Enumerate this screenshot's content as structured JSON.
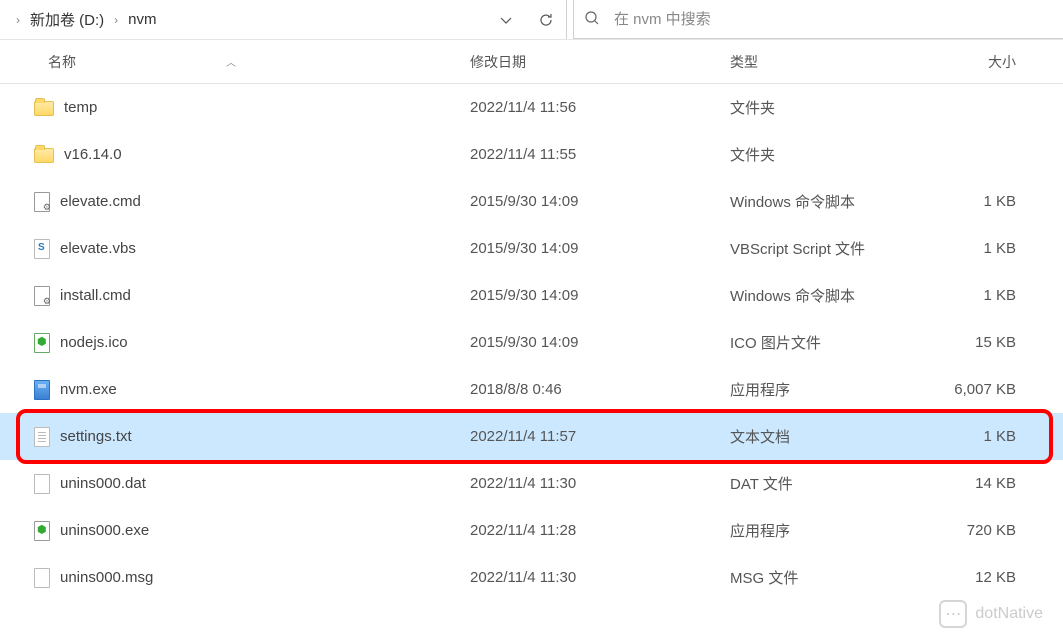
{
  "breadcrumb": {
    "items": [
      "新加卷 (D:)",
      "nvm"
    ]
  },
  "search": {
    "placeholder": "在 nvm 中搜索"
  },
  "columns": {
    "name": "名称",
    "date": "修改日期",
    "type": "类型",
    "size": "大小"
  },
  "files": [
    {
      "name": "temp",
      "date": "2022/11/4 11:56",
      "type": "文件夹",
      "size": "",
      "icon": "folder",
      "selected": false
    },
    {
      "name": "v16.14.0",
      "date": "2022/11/4 11:55",
      "type": "文件夹",
      "size": "",
      "icon": "folder",
      "selected": false
    },
    {
      "name": "elevate.cmd",
      "date": "2015/9/30 14:09",
      "type": "Windows 命令脚本",
      "size": "1 KB",
      "icon": "cmd",
      "selected": false
    },
    {
      "name": "elevate.vbs",
      "date": "2015/9/30 14:09",
      "type": "VBScript Script 文件",
      "size": "1 KB",
      "icon": "vbs",
      "selected": false
    },
    {
      "name": "install.cmd",
      "date": "2015/9/30 14:09",
      "type": "Windows 命令脚本",
      "size": "1 KB",
      "icon": "cmd",
      "selected": false
    },
    {
      "name": "nodejs.ico",
      "date": "2015/9/30 14:09",
      "type": "ICO 图片文件",
      "size": "15 KB",
      "icon": "ico",
      "selected": false
    },
    {
      "name": "nvm.exe",
      "date": "2018/8/8 0:46",
      "type": "应用程序",
      "size": "6,007 KB",
      "icon": "exe",
      "selected": false
    },
    {
      "name": "settings.txt",
      "date": "2022/11/4 11:57",
      "type": "文本文档",
      "size": "1 KB",
      "icon": "txt",
      "selected": true,
      "highlighted": true
    },
    {
      "name": "unins000.dat",
      "date": "2022/11/4 11:30",
      "type": "DAT 文件",
      "size": "14 KB",
      "icon": "file",
      "selected": false
    },
    {
      "name": "unins000.exe",
      "date": "2022/11/4 11:28",
      "type": "应用程序",
      "size": "720 KB",
      "icon": "node",
      "selected": false
    },
    {
      "name": "unins000.msg",
      "date": "2022/11/4 11:30",
      "type": "MSG 文件",
      "size": "12 KB",
      "icon": "file",
      "selected": false
    }
  ],
  "watermark": {
    "text": "dotNative"
  }
}
